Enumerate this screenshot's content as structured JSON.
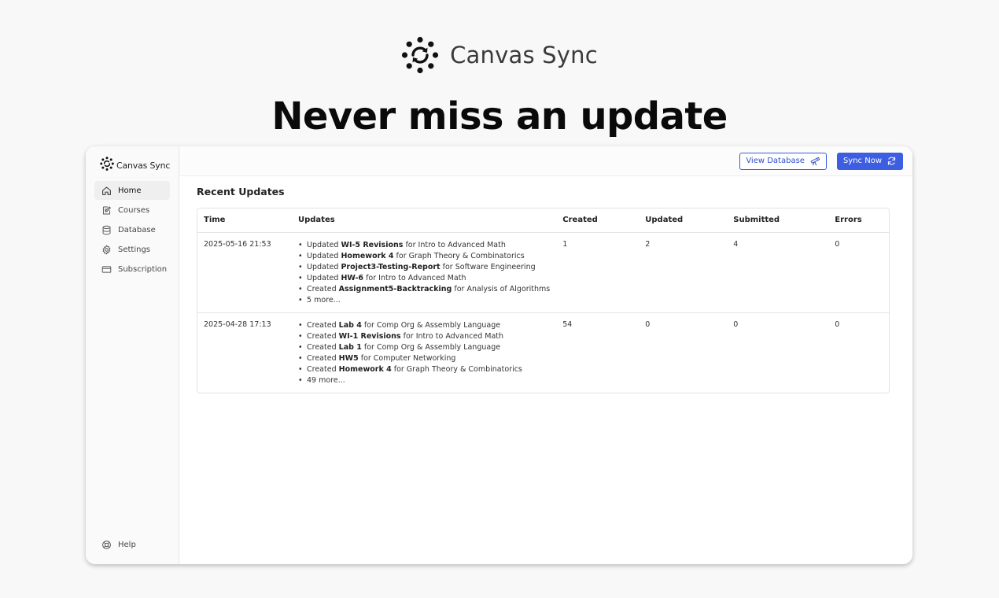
{
  "hero": {
    "brand_name": "Canvas Sync",
    "headline": "Never miss an update"
  },
  "sidebar": {
    "brand_name": "Canvas Sync",
    "items": [
      {
        "label": "Home",
        "icon": "home-icon",
        "active": true
      },
      {
        "label": "Courses",
        "icon": "courses-icon",
        "active": false
      },
      {
        "label": "Database",
        "icon": "database-icon",
        "active": false
      },
      {
        "label": "Settings",
        "icon": "gear-icon",
        "active": false
      },
      {
        "label": "Subscription",
        "icon": "credit-card-icon",
        "active": false
      }
    ],
    "help_label": "Help"
  },
  "topbar": {
    "view_database_label": "View Database",
    "sync_now_label": "Sync Now"
  },
  "recent": {
    "title": "Recent Updates",
    "columns": [
      "Time",
      "Updates",
      "Created",
      "Updated",
      "Submitted",
      "Errors"
    ],
    "rows": [
      {
        "time": "2025-05-16 21:53",
        "updates": [
          {
            "action": "Updated",
            "item": "WI-5 Revisions",
            "course": "for Intro to Advanced Math"
          },
          {
            "action": "Updated",
            "item": "Homework 4",
            "course": "for Graph Theory & Combinatorics"
          },
          {
            "action": "Updated",
            "item": "Project3-Testing-Report",
            "course": "for Software Engineering"
          },
          {
            "action": "Updated",
            "item": "HW-6",
            "course": "for Intro to Advanced Math"
          },
          {
            "action": "Created",
            "item": "Assignment5-Backtracking",
            "course": "for Analysis of Algorithms"
          }
        ],
        "more": "5 more...",
        "created": "1",
        "updated": "2",
        "submitted": "4",
        "errors": "0"
      },
      {
        "time": "2025-04-28 17:13",
        "updates": [
          {
            "action": "Created",
            "item": "Lab 4",
            "course": "for Comp Org & Assembly Language"
          },
          {
            "action": "Created",
            "item": "WI-1 Revisions",
            "course": "for Intro to Advanced Math"
          },
          {
            "action": "Created",
            "item": "Lab 1",
            "course": "for Comp Org & Assembly Language"
          },
          {
            "action": "Created",
            "item": "HW5",
            "course": "for Computer Networking"
          },
          {
            "action": "Created",
            "item": "Homework 4",
            "course": "for Graph Theory & Combinatorics"
          }
        ],
        "more": "49 more...",
        "created": "54",
        "updated": "0",
        "submitted": "0",
        "errors": "0"
      }
    ]
  },
  "colors": {
    "accent": "#3d5ee0",
    "background": "#f8f8f8"
  }
}
